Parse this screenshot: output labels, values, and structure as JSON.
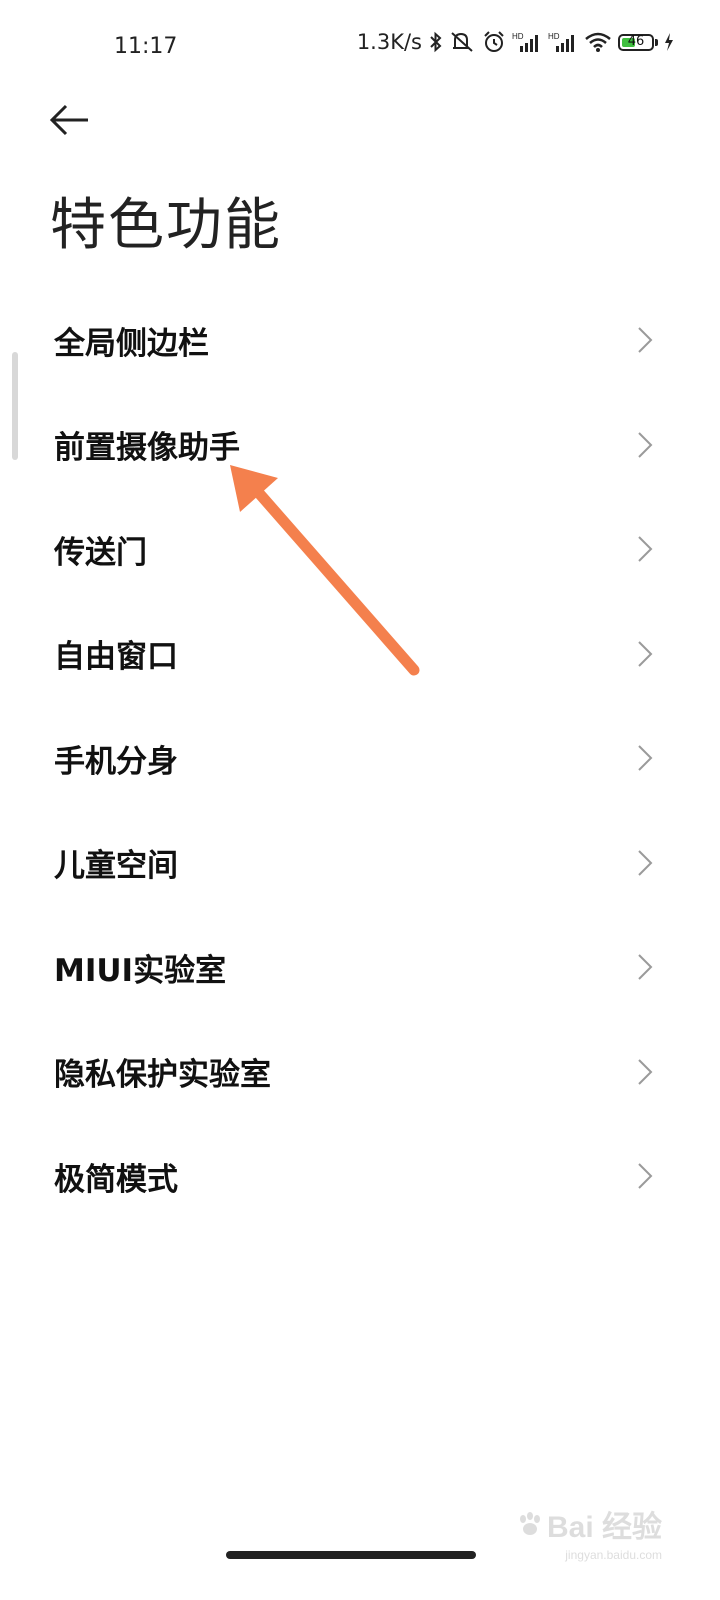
{
  "status_bar": {
    "time": "11:17",
    "network_speed": "1.3K/s",
    "icons": [
      "bluetooth-icon",
      "mute-icon",
      "alarm-icon",
      "hd-signal-icon",
      "hd-signal-icon",
      "wifi-icon",
      "battery-icon",
      "charging-icon"
    ],
    "battery_level": "46",
    "battery_fraction": 0.46,
    "battery_color": "#3fbf3f"
  },
  "header": {
    "back_icon": "arrow-left-icon",
    "title": "特色功能"
  },
  "menu": {
    "items": [
      {
        "label": "全局侧边栏"
      },
      {
        "label": "前置摄像助手"
      },
      {
        "label": "传送门"
      },
      {
        "label": "自由窗口"
      },
      {
        "label": "手机分身"
      },
      {
        "label": "儿童空间"
      },
      {
        "label": "MIUI实验室"
      },
      {
        "label": "隐私保护实验室"
      },
      {
        "label": "极简模式"
      }
    ]
  },
  "annotation": {
    "color": "#f4804d"
  },
  "watermark": {
    "logo_text": "Bai 经验",
    "sub_text": "jingyan.baidu.com"
  }
}
